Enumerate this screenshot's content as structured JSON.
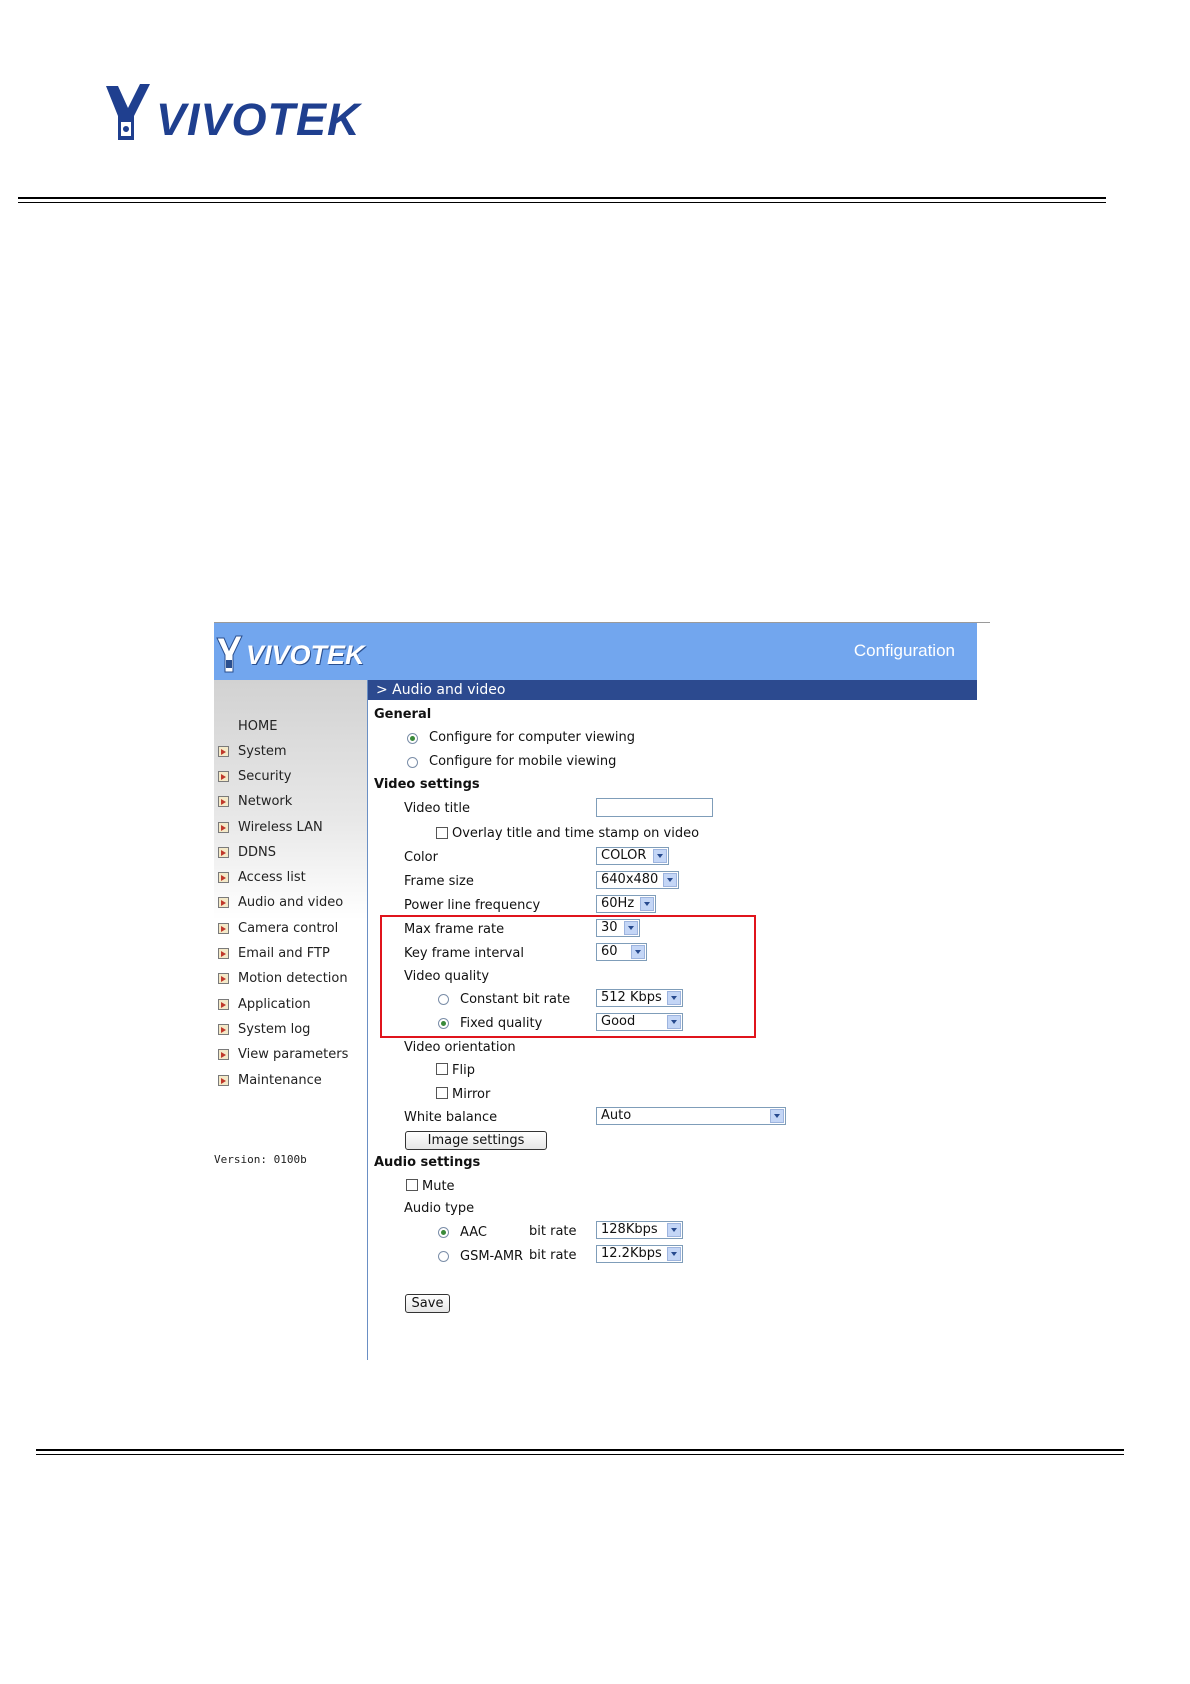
{
  "document": {
    "brand": "VIVOTEK"
  },
  "screenshot": {
    "brand": "VIVOTEK",
    "header_title": "Configuration",
    "section_title": "> Audio and video",
    "menu": [
      {
        "label": "HOME",
        "icon": "none"
      },
      {
        "label": "System",
        "icon": "arrow-icon"
      },
      {
        "label": "Security",
        "icon": "arrow-icon"
      },
      {
        "label": "Network",
        "icon": "arrow-icon"
      },
      {
        "label": "Wireless LAN",
        "icon": "arrow-icon"
      },
      {
        "label": "DDNS",
        "icon": "arrow-icon"
      },
      {
        "label": "Access list",
        "icon": "arrow-icon"
      },
      {
        "label": "Audio and video",
        "icon": "arrow-icon"
      },
      {
        "label": "Camera control",
        "icon": "arrow-icon"
      },
      {
        "label": "Email and FTP",
        "icon": "arrow-icon"
      },
      {
        "label": "Motion detection",
        "icon": "arrow-icon"
      },
      {
        "label": "Application",
        "icon": "arrow-icon"
      },
      {
        "label": "System log",
        "icon": "arrow-icon"
      },
      {
        "label": "View parameters",
        "icon": "arrow-icon"
      },
      {
        "label": "Maintenance",
        "icon": "arrow-icon"
      }
    ],
    "version": "Version: 0100b",
    "general": {
      "heading": "General",
      "option_computer": "Configure for computer viewing",
      "option_mobile": "Configure for mobile viewing",
      "selected": "computer"
    },
    "video": {
      "heading": "Video settings",
      "title_label": "Video title",
      "title_value": "",
      "overlay_label": "Overlay title and time stamp on video",
      "overlay_checked": false,
      "color_label": "Color",
      "color_value": "COLOR",
      "frame_size_label": "Frame size",
      "frame_size_value": "640x480",
      "power_label": "Power line frequency",
      "power_value": "60Hz",
      "max_rate_label": "Max frame rate",
      "max_rate_value": "30",
      "key_interval_label": "Key frame interval",
      "key_interval_value": "60",
      "quality_label": "Video quality",
      "cbr_label": "Constant bit rate",
      "cbr_value": "512 Kbps",
      "fixed_label": "Fixed quality",
      "fixed_value": "Good",
      "quality_selected": "fixed",
      "orientation_label": "Video orientation",
      "flip_label": "Flip",
      "mirror_label": "Mirror",
      "wb_label": "White balance",
      "wb_value": "Auto",
      "image_settings_button": "Image settings"
    },
    "audio": {
      "heading": "Audio settings",
      "mute_label": "Mute",
      "type_label": "Audio type",
      "aac_label": "AAC",
      "aac_bitrate_label": "bit rate",
      "aac_bitrate_value": "128Kbps",
      "gsm_label": "GSM-AMR",
      "gsm_bitrate_label": "bit rate",
      "gsm_bitrate_value": "12.2Kbps",
      "selected": "aac"
    },
    "save_button": "Save",
    "highlight_color": "#e0141c",
    "header_color": "#72a6ee",
    "section_bar_color": "#2c4a8f"
  }
}
